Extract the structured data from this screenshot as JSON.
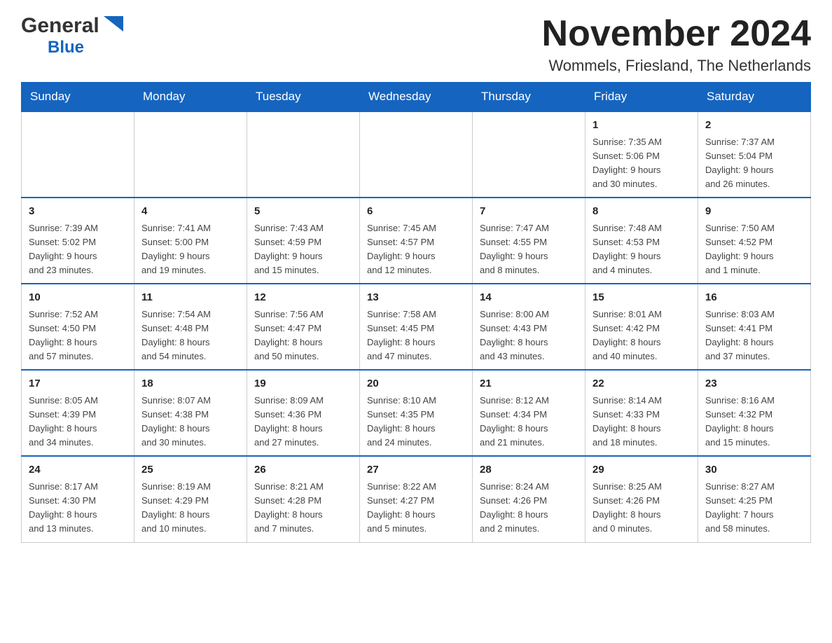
{
  "header": {
    "logo_general": "General",
    "logo_blue": "Blue",
    "month_title": "November 2024",
    "location": "Wommels, Friesland, The Netherlands"
  },
  "days_of_week": [
    "Sunday",
    "Monday",
    "Tuesday",
    "Wednesday",
    "Thursday",
    "Friday",
    "Saturday"
  ],
  "weeks": [
    [
      {
        "day": "",
        "info": ""
      },
      {
        "day": "",
        "info": ""
      },
      {
        "day": "",
        "info": ""
      },
      {
        "day": "",
        "info": ""
      },
      {
        "day": "",
        "info": ""
      },
      {
        "day": "1",
        "info": "Sunrise: 7:35 AM\nSunset: 5:06 PM\nDaylight: 9 hours\nand 30 minutes."
      },
      {
        "day": "2",
        "info": "Sunrise: 7:37 AM\nSunset: 5:04 PM\nDaylight: 9 hours\nand 26 minutes."
      }
    ],
    [
      {
        "day": "3",
        "info": "Sunrise: 7:39 AM\nSunset: 5:02 PM\nDaylight: 9 hours\nand 23 minutes."
      },
      {
        "day": "4",
        "info": "Sunrise: 7:41 AM\nSunset: 5:00 PM\nDaylight: 9 hours\nand 19 minutes."
      },
      {
        "day": "5",
        "info": "Sunrise: 7:43 AM\nSunset: 4:59 PM\nDaylight: 9 hours\nand 15 minutes."
      },
      {
        "day": "6",
        "info": "Sunrise: 7:45 AM\nSunset: 4:57 PM\nDaylight: 9 hours\nand 12 minutes."
      },
      {
        "day": "7",
        "info": "Sunrise: 7:47 AM\nSunset: 4:55 PM\nDaylight: 9 hours\nand 8 minutes."
      },
      {
        "day": "8",
        "info": "Sunrise: 7:48 AM\nSunset: 4:53 PM\nDaylight: 9 hours\nand 4 minutes."
      },
      {
        "day": "9",
        "info": "Sunrise: 7:50 AM\nSunset: 4:52 PM\nDaylight: 9 hours\nand 1 minute."
      }
    ],
    [
      {
        "day": "10",
        "info": "Sunrise: 7:52 AM\nSunset: 4:50 PM\nDaylight: 8 hours\nand 57 minutes."
      },
      {
        "day": "11",
        "info": "Sunrise: 7:54 AM\nSunset: 4:48 PM\nDaylight: 8 hours\nand 54 minutes."
      },
      {
        "day": "12",
        "info": "Sunrise: 7:56 AM\nSunset: 4:47 PM\nDaylight: 8 hours\nand 50 minutes."
      },
      {
        "day": "13",
        "info": "Sunrise: 7:58 AM\nSunset: 4:45 PM\nDaylight: 8 hours\nand 47 minutes."
      },
      {
        "day": "14",
        "info": "Sunrise: 8:00 AM\nSunset: 4:43 PM\nDaylight: 8 hours\nand 43 minutes."
      },
      {
        "day": "15",
        "info": "Sunrise: 8:01 AM\nSunset: 4:42 PM\nDaylight: 8 hours\nand 40 minutes."
      },
      {
        "day": "16",
        "info": "Sunrise: 8:03 AM\nSunset: 4:41 PM\nDaylight: 8 hours\nand 37 minutes."
      }
    ],
    [
      {
        "day": "17",
        "info": "Sunrise: 8:05 AM\nSunset: 4:39 PM\nDaylight: 8 hours\nand 34 minutes."
      },
      {
        "day": "18",
        "info": "Sunrise: 8:07 AM\nSunset: 4:38 PM\nDaylight: 8 hours\nand 30 minutes."
      },
      {
        "day": "19",
        "info": "Sunrise: 8:09 AM\nSunset: 4:36 PM\nDaylight: 8 hours\nand 27 minutes."
      },
      {
        "day": "20",
        "info": "Sunrise: 8:10 AM\nSunset: 4:35 PM\nDaylight: 8 hours\nand 24 minutes."
      },
      {
        "day": "21",
        "info": "Sunrise: 8:12 AM\nSunset: 4:34 PM\nDaylight: 8 hours\nand 21 minutes."
      },
      {
        "day": "22",
        "info": "Sunrise: 8:14 AM\nSunset: 4:33 PM\nDaylight: 8 hours\nand 18 minutes."
      },
      {
        "day": "23",
        "info": "Sunrise: 8:16 AM\nSunset: 4:32 PM\nDaylight: 8 hours\nand 15 minutes."
      }
    ],
    [
      {
        "day": "24",
        "info": "Sunrise: 8:17 AM\nSunset: 4:30 PM\nDaylight: 8 hours\nand 13 minutes."
      },
      {
        "day": "25",
        "info": "Sunrise: 8:19 AM\nSunset: 4:29 PM\nDaylight: 8 hours\nand 10 minutes."
      },
      {
        "day": "26",
        "info": "Sunrise: 8:21 AM\nSunset: 4:28 PM\nDaylight: 8 hours\nand 7 minutes."
      },
      {
        "day": "27",
        "info": "Sunrise: 8:22 AM\nSunset: 4:27 PM\nDaylight: 8 hours\nand 5 minutes."
      },
      {
        "day": "28",
        "info": "Sunrise: 8:24 AM\nSunset: 4:26 PM\nDaylight: 8 hours\nand 2 minutes."
      },
      {
        "day": "29",
        "info": "Sunrise: 8:25 AM\nSunset: 4:26 PM\nDaylight: 8 hours\nand 0 minutes."
      },
      {
        "day": "30",
        "info": "Sunrise: 8:27 AM\nSunset: 4:25 PM\nDaylight: 7 hours\nand 58 minutes."
      }
    ]
  ]
}
